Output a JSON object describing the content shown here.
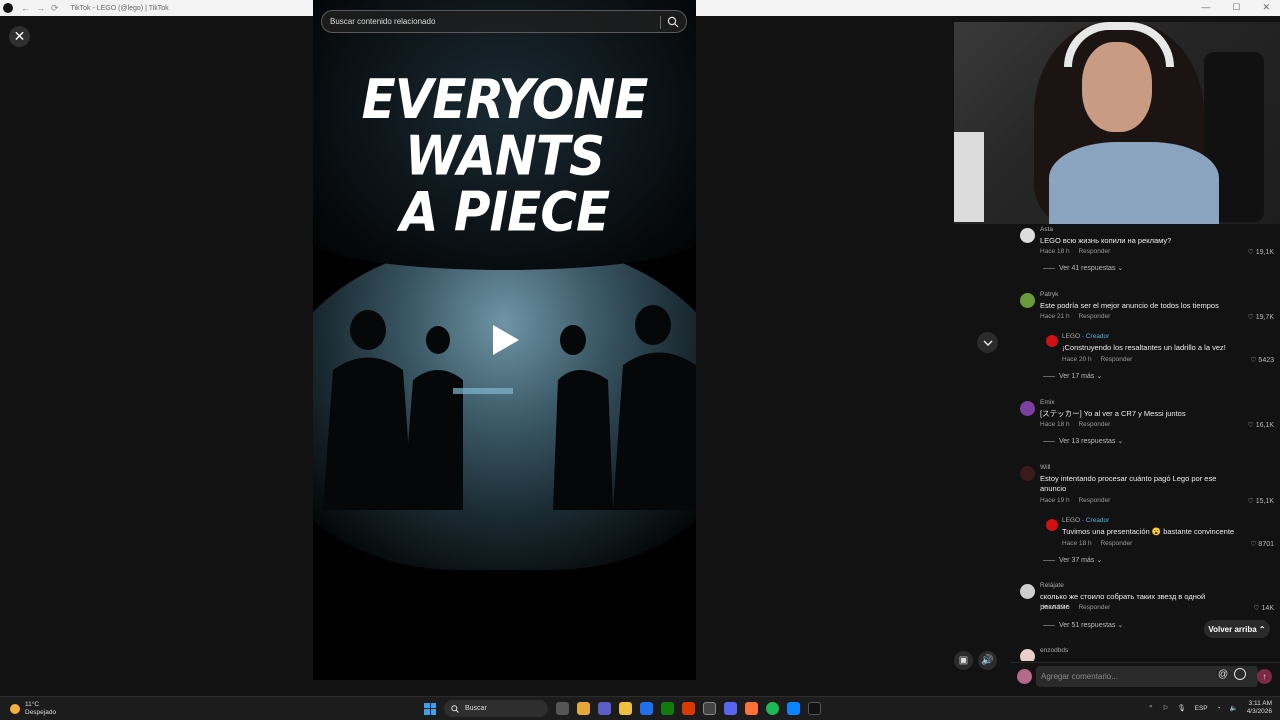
{
  "window": {
    "title": "TikTok - LEGO (@lego) | TikTok"
  },
  "search": {
    "placeholder": "Buscar contenido relacionado"
  },
  "video": {
    "headline_lines": [
      "EVERYONE",
      "WANTS",
      "A PIECE"
    ]
  },
  "comments": [
    {
      "user": "Asta",
      "text": "LEGO всю жизнь копили на рекламу?",
      "time": "Hace 18 h",
      "reply_label": "Responder",
      "likes": "19,1K",
      "more": "Ver 41 respuestas"
    },
    {
      "user": "Patryk",
      "text": "Este podría ser el mejor anuncio de todos los tiempos",
      "time": "Hace 21 h",
      "reply_label": "Responder",
      "likes": "19,7K",
      "reply": {
        "user": "LEGO",
        "creator": "· Creador",
        "text": "¡Construyendo los resaltantes un ladrillo a la vez!",
        "time": "Hace 20 h",
        "reply_label": "Responder",
        "likes": "5423"
      },
      "more": "Ver 17 más"
    },
    {
      "user": "Emix",
      "text": "[ステッカー] Yo al ver a CR7 y Messi juntos",
      "time": "Hace 18 h",
      "reply_label": "Responder",
      "likes": "16,1K",
      "more": "Ver 13 respuestas"
    },
    {
      "user": "Will",
      "text": "Estoy intentando procesar cuánto pagó Lego por ese anuncio",
      "time": "Hace 19 h",
      "reply_label": "Responder",
      "likes": "15,1K",
      "reply": {
        "user": "LEGO",
        "creator": "· Creador",
        "text": "Tuvimos una presentación 😮 bastante convincente",
        "time": "Hace 18 h",
        "reply_label": "Responder",
        "likes": "8701"
      },
      "more": "Ver 37 más"
    },
    {
      "user": "Relájate",
      "text": "сколько же стоило собрать таких звезд в одной рекламе",
      "time": "Hace 20 h",
      "reply_label": "Responder",
      "likes": "14K",
      "more": "Ver 51 respuestas"
    },
    {
      "user": "enzodbds"
    }
  ],
  "volver": "Volver arriba",
  "comment_input": {
    "placeholder": "Agregar comentario..."
  },
  "taskbar": {
    "weather_temp": "11°C",
    "weather_desc": "Despejado",
    "search_label": "Buscar",
    "lang": "ESP",
    "time": "3:11 AM",
    "date": "4/3/2026"
  },
  "colors": {
    "lego_red": "#d01012",
    "creator_blue": "#4fb1e0",
    "background": "#121212"
  }
}
